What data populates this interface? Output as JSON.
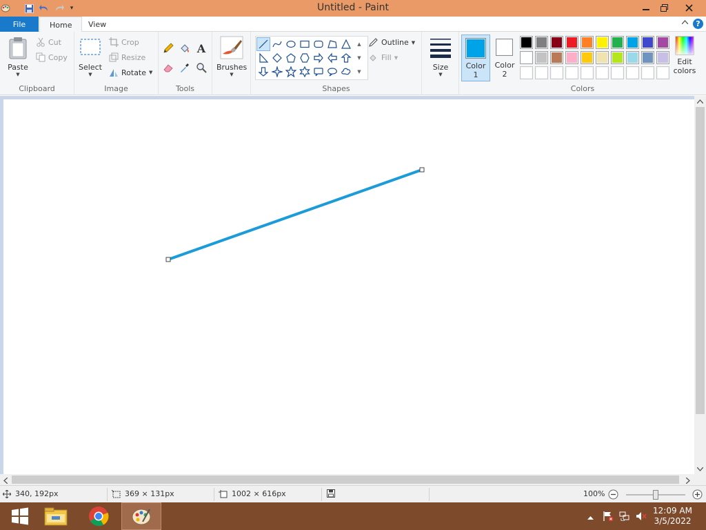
{
  "window": {
    "title": "Untitled - Paint"
  },
  "tabs": {
    "file": "File",
    "home": "Home",
    "view": "View",
    "help": "?"
  },
  "ribbon": {
    "clipboard": {
      "label": "Clipboard",
      "paste": "Paste",
      "cut": "Cut",
      "copy": "Copy"
    },
    "image": {
      "label": "Image",
      "select": "Select",
      "crop": "Crop",
      "resize": "Resize",
      "rotate": "Rotate"
    },
    "tools": {
      "label": "Tools",
      "text_icon": "A"
    },
    "brushes": {
      "label": "Brushes"
    },
    "shapes": {
      "label": "Shapes",
      "outline": "Outline",
      "fill": "Fill",
      "selected_shape": "line"
    },
    "size": {
      "label": "Size"
    },
    "colors": {
      "label": "Colors",
      "color1_label": "Color",
      "color1_num": "1",
      "color2_label": "Color",
      "color2_num": "2",
      "color1_value": "#00a2e8",
      "color2_value": "#ffffff",
      "edit": "Edit",
      "edit2": "colors",
      "palette_row1": [
        "#000000",
        "#7f7f7f",
        "#880015",
        "#ed1c24",
        "#ff7f27",
        "#fff200",
        "#22b14c",
        "#00a2e8",
        "#3f48cc",
        "#a349a4"
      ],
      "palette_row2": [
        "#ffffff",
        "#c3c3c3",
        "#b97a57",
        "#ffaec9",
        "#ffc90e",
        "#efe4b0",
        "#b5e61d",
        "#99d9ea",
        "#7092be",
        "#c8bfe7"
      ],
      "palette_row3": [
        "#ffffff",
        "#ffffff",
        "#ffffff",
        "#ffffff",
        "#ffffff",
        "#ffffff",
        "#ffffff",
        "#ffffff",
        "#ffffff",
        "#ffffff"
      ]
    }
  },
  "canvas": {
    "line_color": "#1b9bd7"
  },
  "status": {
    "cursor_pos": "340, 192px",
    "selection_size": "369 × 131px",
    "canvas_size": "1002 × 616px",
    "zoom": "100%"
  },
  "taskbar": {
    "time": "12:09 AM",
    "date": "3/5/2022"
  }
}
